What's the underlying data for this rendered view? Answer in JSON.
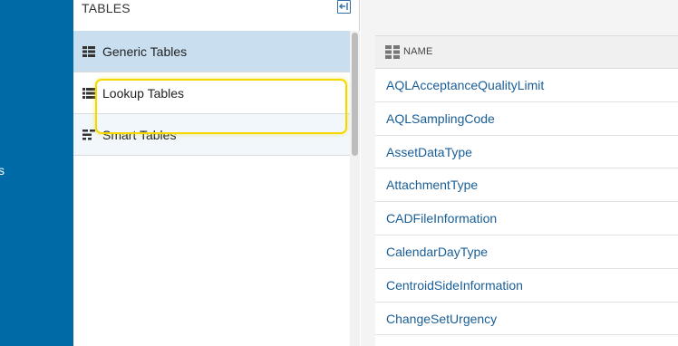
{
  "left_nav": {
    "partial_text": "s"
  },
  "tables_panel": {
    "title": "TABLES",
    "items": [
      {
        "label": "Generic Tables",
        "icon": "generic-table-icon",
        "state": "selected"
      },
      {
        "label": "Lookup Tables",
        "icon": "list-icon",
        "state": "normal"
      },
      {
        "label": "Smart Tables",
        "icon": "smart-table-icon",
        "state": "highlighted"
      }
    ]
  },
  "name_table": {
    "header": "NAME",
    "rows": [
      "AQLAcceptanceQualityLimit",
      "AQLSamplingCode",
      "AssetDataType",
      "AttachmentType",
      "CADFileInformation",
      "CalendarDayType",
      "CentroidSideInformation",
      "ChangeSetUrgency"
    ]
  },
  "colors": {
    "nav_background": "#006aa6",
    "selected_row": "#c9dfef",
    "focus_ring": "#f5d800",
    "link": "#1a5e96"
  }
}
